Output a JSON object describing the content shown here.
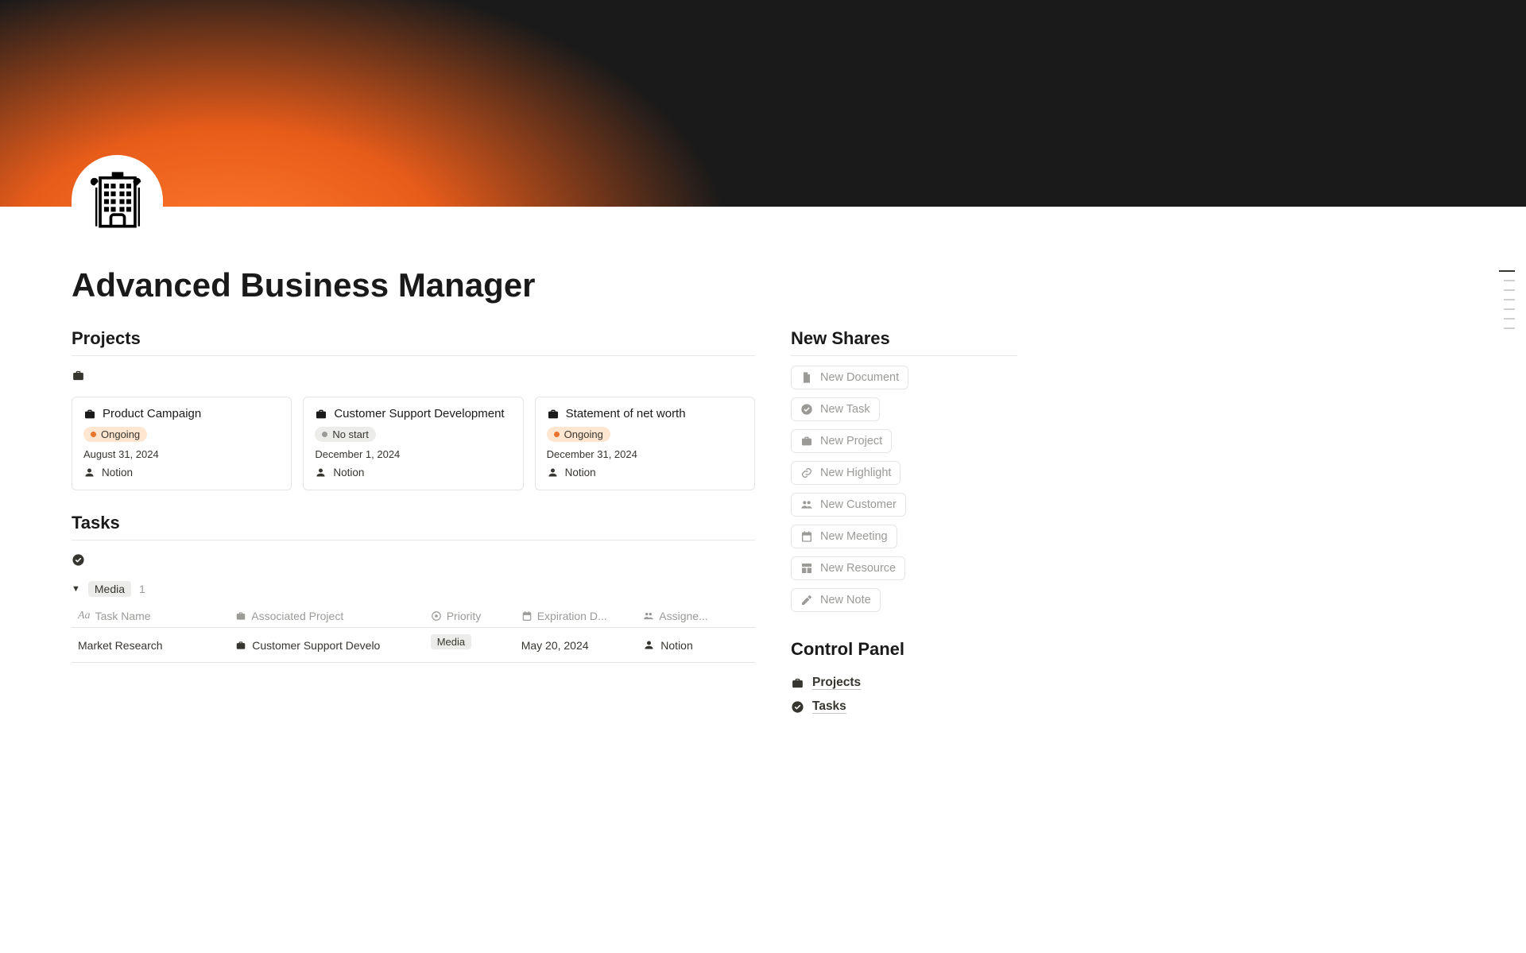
{
  "page": {
    "title": "Advanced Business Manager"
  },
  "projects": {
    "heading": "Projects",
    "cards": [
      {
        "title": "Product Campaign",
        "status": "Ongoing",
        "status_kind": "ongoing",
        "date": "August 31, 2024",
        "owner": "Notion"
      },
      {
        "title": "Customer Support Development",
        "status": "No start",
        "status_kind": "nostart",
        "date": "December 1, 2024",
        "owner": "Notion"
      },
      {
        "title": "Statement of net worth",
        "status": "Ongoing",
        "status_kind": "ongoing",
        "date": "December 31, 2024",
        "owner": "Notion"
      }
    ]
  },
  "tasks": {
    "heading": "Tasks",
    "group": {
      "name": "Media",
      "count": "1"
    },
    "columns": {
      "name": "Task Name",
      "project": "Associated Project",
      "priority": "Priority",
      "expiration": "Expiration D...",
      "assignee": "Assigne..."
    },
    "rows": [
      {
        "name": "Market Research",
        "project": "Customer Support Develo",
        "priority": "Media",
        "expiration": "May 20, 2024",
        "assignee": "Notion"
      }
    ]
  },
  "shares": {
    "heading": "New Shares",
    "buttons": [
      {
        "key": "document",
        "label": "New Document",
        "icon": "doc"
      },
      {
        "key": "task",
        "label": "New Task",
        "icon": "check"
      },
      {
        "key": "project",
        "label": "New Project",
        "icon": "briefcase"
      },
      {
        "key": "highlight",
        "label": "New Highlight",
        "icon": "link"
      },
      {
        "key": "customer",
        "label": "New Customer",
        "icon": "people"
      },
      {
        "key": "meeting",
        "label": "New Meeting",
        "icon": "calendar"
      },
      {
        "key": "resource",
        "label": "New Resource",
        "icon": "layout"
      },
      {
        "key": "note",
        "label": "New Note",
        "icon": "pencil"
      }
    ]
  },
  "control_panel": {
    "heading": "Control Panel",
    "items": [
      {
        "key": "projects",
        "label": "Projects",
        "icon": "briefcase"
      },
      {
        "key": "tasks",
        "label": "Tasks",
        "icon": "check"
      }
    ]
  }
}
